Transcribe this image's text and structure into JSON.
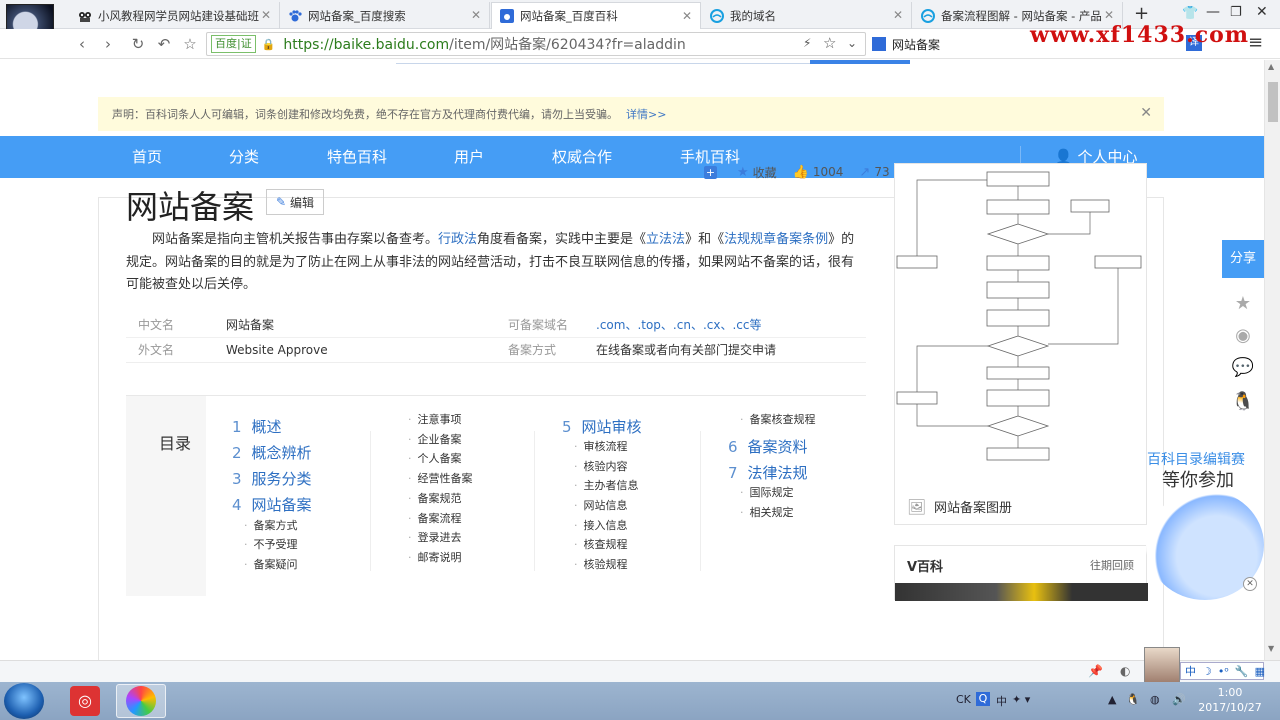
{
  "browser": {
    "tabs": [
      {
        "label": "小风教程网学员网站建设基础班",
        "icon": "owl-icon"
      },
      {
        "label": "网站备案_百度搜索",
        "icon": "paw-icon"
      },
      {
        "label": "网站备案_百度百科",
        "icon": "baike-icon",
        "active": true
      },
      {
        "label": "我的域名",
        "icon": "cloud-icon"
      },
      {
        "label": "备案流程图解 - 网站备案 - 产品",
        "icon": "cloud-icon"
      }
    ],
    "new_tab": "+",
    "url_badge_left": "百度",
    "url_badge_right": "证",
    "url_host": "https://baike.baidu.com",
    "url_path": "/item/网站备案/620434?fr=aladdin",
    "search_text": "网站备案",
    "watermark": "www.xf1433.com",
    "translate_label": "译"
  },
  "notice": {
    "text": "声明：百科词条人人可编辑，词条创建和修改均免费，绝不存在官方及代理商付费代编，请勿上当受骗。",
    "link": "详情>>"
  },
  "topnav": {
    "items": [
      "首页",
      "分类",
      "特色百科",
      "用户",
      "权威合作",
      "手机百科"
    ],
    "user_center": "个人中心"
  },
  "entry": {
    "title": "网站备案",
    "edit_label": "编辑",
    "actions": {
      "collect": "收藏",
      "likes": "1004",
      "shares": "73"
    },
    "summary": {
      "p1": "网站备案是指向主管机关报告事由存案以备查考。",
      "link1": "行政法",
      "p2": "角度看备案，实践中主要是《",
      "link2": "立法法",
      "p3": "》和《",
      "link3": "法规规章备案条例",
      "p4": "》的规定。网站备案的目的就是为了防止在网上从事非法的网站经营活动，打击不良互联网信息的传播，如果网站不备案的话，很有可能被查处以后关停。"
    },
    "basic_info": [
      {
        "key": "中文名",
        "value": "网站备案"
      },
      {
        "key": "外文名",
        "value": "Website Approve"
      },
      {
        "key": "可备案域名",
        "value": ".com、.top、.cn、.cx、.cc等"
      },
      {
        "key": "备案方式",
        "value": "在线备案或者向有关部门提交申请"
      }
    ]
  },
  "catalog": {
    "title": "目录",
    "col1": [
      {
        "num": "1",
        "label": "概述"
      },
      {
        "num": "2",
        "label": "概念辨析"
      },
      {
        "num": "3",
        "label": "服务分类"
      },
      {
        "num": "4",
        "label": "网站备案"
      }
    ],
    "col1_sub": [
      "备案方式",
      "不予受理",
      "备案疑问"
    ],
    "col2_sub": [
      "注意事项",
      "企业备案",
      "个人备案",
      "经营性备案",
      "备案规范",
      "备案流程",
      "登录进去",
      "邮寄说明"
    ],
    "col3": [
      {
        "num": "5",
        "label": "网站审核"
      }
    ],
    "col3_sub": [
      "审核流程",
      "核验内容",
      "主办者信息",
      "网站信息",
      "接入信息",
      "核查规程",
      "核验规程"
    ],
    "col4_top": "备案核查规程",
    "col4": [
      {
        "num": "6",
        "label": "备案资料"
      },
      {
        "num": "7",
        "label": "法律法规"
      }
    ],
    "col4_sub": [
      "国际规定",
      "相关规定"
    ]
  },
  "sidebar": {
    "album_label": "网站备案图册",
    "vbaike_title": "V百科",
    "vbaike_more": "往期回顾",
    "share": "分享",
    "promo_line1": "百科目录编辑赛",
    "promo_line2": "等你参加"
  },
  "taskbar": {
    "time": "1:00",
    "date": "2017/10/27",
    "ime": "中",
    "ck": "CK"
  }
}
